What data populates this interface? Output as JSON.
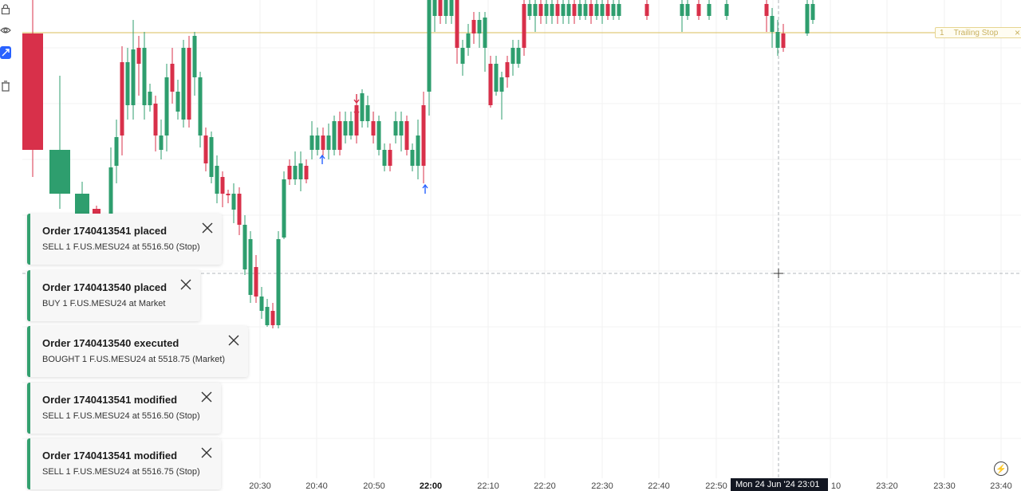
{
  "toolbar": {
    "tools": [
      {
        "icon": "lock-icon",
        "active": false
      },
      {
        "icon": "eye-icon",
        "active": false
      },
      {
        "icon": "link-icon",
        "active": true
      },
      {
        "icon": "trash-icon",
        "active": false
      }
    ]
  },
  "colors": {
    "up": "#2e9e6e",
    "down": "#d8304a",
    "accent_toolbar": "#2962ff",
    "trailing_line": "#e0c97a",
    "toast_border": "#33a06f"
  },
  "horizontal_line": {
    "number": "1",
    "label": "Trailing Stop",
    "close_glyph": "×"
  },
  "notifications": [
    {
      "title": "Order 1740413541 placed",
      "body": "SELL 1 F.US.MESU24 at 5516.50  (Stop)"
    },
    {
      "title": "Order 1740413540 placed",
      "body": "BUY 1 F.US.MESU24 at Market"
    },
    {
      "title": "Order 1740413540 executed",
      "body": "BOUGHT 1 F.US.MESU24 at 5518.75  (Market)"
    },
    {
      "title": "Order 1740413541 modified",
      "body": "SELL 1 F.US.MESU24 at 5516.50  (Stop)"
    },
    {
      "title": "Order 1740413541 modified",
      "body": "SELL 1 F.US.MESU24 at 5516.75  (Stop)"
    }
  ],
  "time_axis": {
    "labels": [
      "20:30",
      "20:40",
      "20:50",
      "22:00",
      "22:10",
      "22:20",
      "22:30",
      "22:40",
      "22:50",
      "10",
      "23:20",
      "23:30",
      "23:40"
    ],
    "bold_label": "22:00",
    "crosshair_label": "Mon 24 Jun '24   23:01"
  },
  "candles_trend": [
    [
      0,
      1,
      0
    ],
    [
      1,
      0.7,
      1
    ],
    [
      1,
      0.5,
      0
    ],
    [
      0,
      0.2,
      1
    ],
    [
      1,
      0.3,
      1
    ],
    [
      0,
      0.8,
      0
    ],
    [
      1,
      0.2,
      1
    ],
    [
      0,
      0.6,
      1
    ]
  ]
}
